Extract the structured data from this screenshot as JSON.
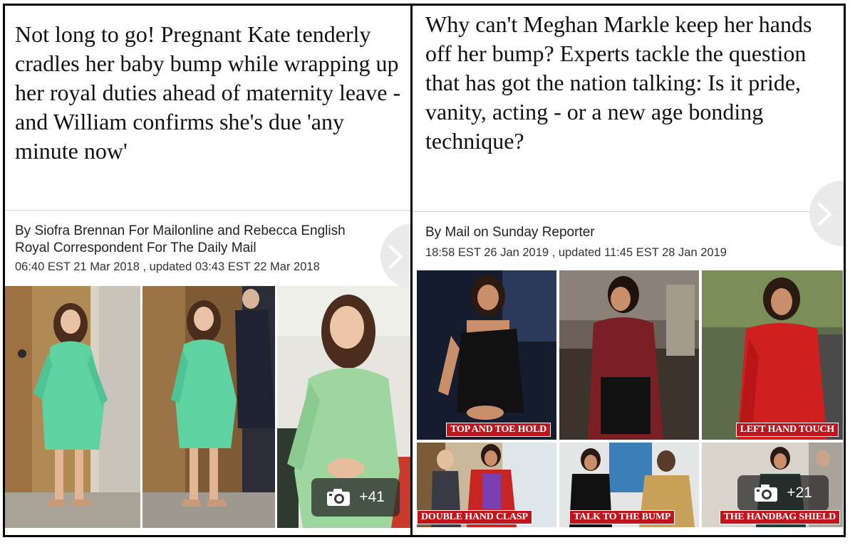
{
  "left_article": {
    "headline": "Not long to go! Pregnant Kate tenderly cradles her baby bump while wrapping up her royal duties ahead of maternity leave - and William confirms she's due 'any minute now'",
    "byline_line1": "By Siofra Brennan For Mailonline and Rebecca English",
    "byline_line2": "Royal Correspondent For The Daily Mail",
    "timestamp": "06:40 EST 21 Mar 2018 , updated 03:43 EST 22 Mar 2018",
    "photo_count": "+41",
    "next_icon": "chevron-right-icon",
    "camera_icon": "camera-icon"
  },
  "right_article": {
    "headline": "Why can't Meghan Markle keep her hands off her bump? Experts tackle the question that has got the nation talking: Is it pride, vanity, acting - or a new age bonding technique?",
    "byline": "By Mail on Sunday Reporter",
    "timestamp": "18:58 EST 26 Jan 2019 , updated 11:45 EST 28 Jan 2019",
    "photo_count": "+21",
    "captions": [
      "TOP AND TOE HOLD",
      "LEFT HAND TOUCH",
      "DOUBLE HAND CLASP",
      "TALK TO THE BUMP",
      "THE HANDBAG SHIELD"
    ],
    "next_icon": "chevron-right-icon",
    "camera_icon": "camera-icon"
  },
  "colors": {
    "caption_red": "#c0151c",
    "mint_coat": "#5fd2a2",
    "pale_green_coat": "#9ed6a0",
    "burgundy": "#7a1f24",
    "red_coat": "#d01f1f"
  }
}
